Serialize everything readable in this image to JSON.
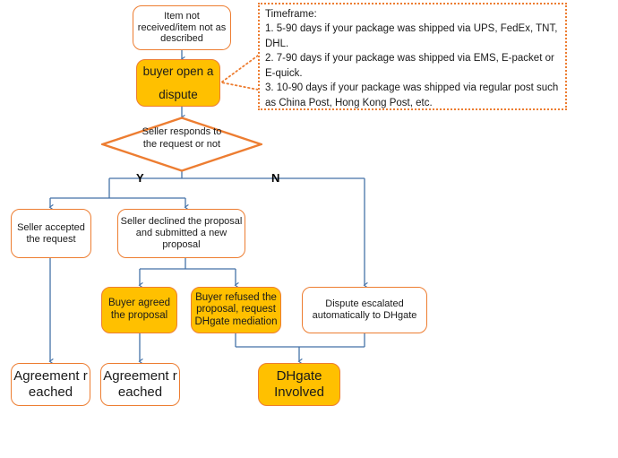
{
  "diagram": {
    "title": "DHgate dispute resolution flowchart",
    "colors": {
      "box_fill_orange": "#FFC000",
      "box_fill_white": "#FFFFFF",
      "box_border": "#ED7D31",
      "connector": "#4472A8",
      "callout_border": "#ED7D31",
      "text": "#1A1A1A"
    },
    "nodes": {
      "start": "Item not received/item not as described",
      "open_dispute": "buyer open a dispute",
      "decision": "Seller responds to the request or not",
      "seller_accepted": "Seller accepted the request",
      "seller_declined": "Seller declined the proposal and submitted a new proposal",
      "buyer_agreed": "Buyer agreed the proposal",
      "buyer_refused": "Buyer refused the proposal, request DHgate mediation",
      "dispute_escalated": "Dispute escalated automatically to DHgate",
      "agreement_reached_1": "Agreement reached",
      "agreement_reached_2": "Agreement reached",
      "dhgate_involved": "DHgate Involved"
    },
    "branch_labels": {
      "yes": "Y",
      "no": "N"
    },
    "callout": {
      "heading": "Timeframe:",
      "line1": "1. 5-90 days if your package was shipped via UPS, FedEx, TNT, DHL.",
      "line2": "2. 7-90 days if your package was shipped via EMS, E-packet or E-quick.",
      "line3": "3. 10-90 days if your package was shipped via regular post such as China Post, Hong Kong Post, etc."
    }
  }
}
